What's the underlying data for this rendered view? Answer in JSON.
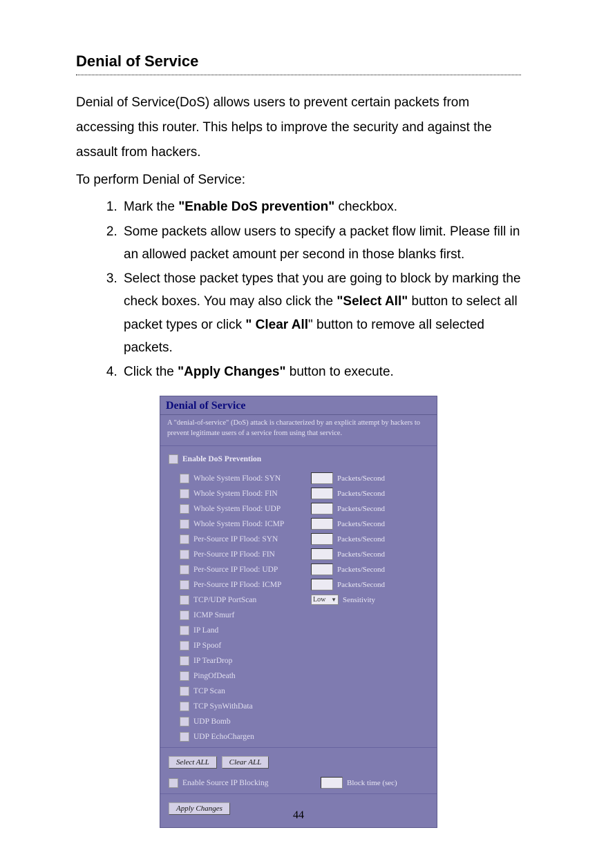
{
  "heading": "Denial of Service",
  "intro1": "Denial of Service(DoS) allows users to prevent certain packets from accessing this router. This helps to improve the security and against the assault from hackers.",
  "intro2": "To perform Denial of Service:",
  "steps": {
    "s1_a": "Mark the ",
    "s1_b": "\"Enable DoS prevention\"",
    "s1_c": " checkbox.",
    "s2": "Some packets allow users to specify a packet flow limit. Please fill in an allowed packet amount per second in those blanks first.",
    "s3_a": "Select those packet types that you are going to block by marking the check boxes. You may also click the ",
    "s3_b": "\"Select All\"",
    "s3_c": " button to select all packet types or click ",
    "s3_d": "\" Clear All",
    "s3_e": "\" button to remove all selected packets.",
    "s4_a": "Click the ",
    "s4_b": "\"Apply Changes\"",
    "s4_c": " button to execute."
  },
  "panel": {
    "title": "Denial of Service",
    "desc": "A \"denial-of-service\" (DoS) attack is characterized by an explicit attempt by hackers to prevent legitimate users of a service from using that service.",
    "enable_label": "Enable DoS Prevention",
    "packets_unit": "Packets/Second",
    "sensitivity_label": "Sensitivity",
    "sensitivity_value": "Low",
    "block_time_label": "Block time (sec)",
    "items_with_field": [
      "Whole System Flood: SYN",
      "Whole System Flood: FIN",
      "Whole System Flood: UDP",
      "Whole System Flood: ICMP",
      "Per-Source IP Flood: SYN",
      "Per-Source IP Flood: FIN",
      "Per-Source IP Flood: UDP",
      "Per-Source IP Flood: ICMP"
    ],
    "portscan_label": "TCP/UDP PortScan",
    "items_plain": [
      "ICMP Smurf",
      "IP Land",
      "IP Spoof",
      "IP TearDrop",
      "PingOfDeath",
      "TCP Scan",
      "TCP SynWithData",
      "UDP Bomb",
      "UDP EchoChargen"
    ],
    "source_block_label": "Enable Source IP Blocking",
    "btn_select_all": "Select ALL",
    "btn_clear_all": "Clear ALL",
    "btn_apply": "Apply Changes"
  },
  "page_number": "44"
}
